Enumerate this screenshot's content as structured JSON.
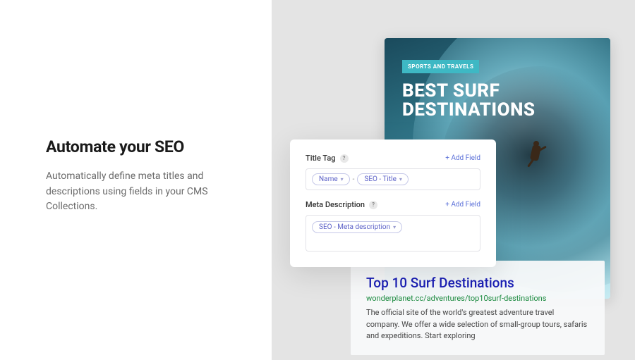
{
  "left": {
    "heading": "Automate your SEO",
    "description": "Automatically define meta titles and descriptions using fields in your CMS Collections."
  },
  "hero": {
    "category": "SPORTS AND TRAVELS",
    "title": "BEST SURF DESTINATIONS"
  },
  "seo_panel": {
    "title_tag": {
      "label": "Title Tag",
      "add_field": "+ Add Field",
      "tokens": [
        "Name",
        "SEO - Title"
      ],
      "separator": "-"
    },
    "meta_description": {
      "label": "Meta Description",
      "add_field": "+ Add Field",
      "tokens": [
        "SEO - Meta description"
      ]
    }
  },
  "serp": {
    "title": "Top 10 Surf Destinations",
    "url": "wonderplanet.cc/adventures/top10surf-destinations",
    "description": "The official site of the world's greatest adventure travel company. We offer a wide selection of small-group tours, safaris and expeditions. Start exploring"
  }
}
